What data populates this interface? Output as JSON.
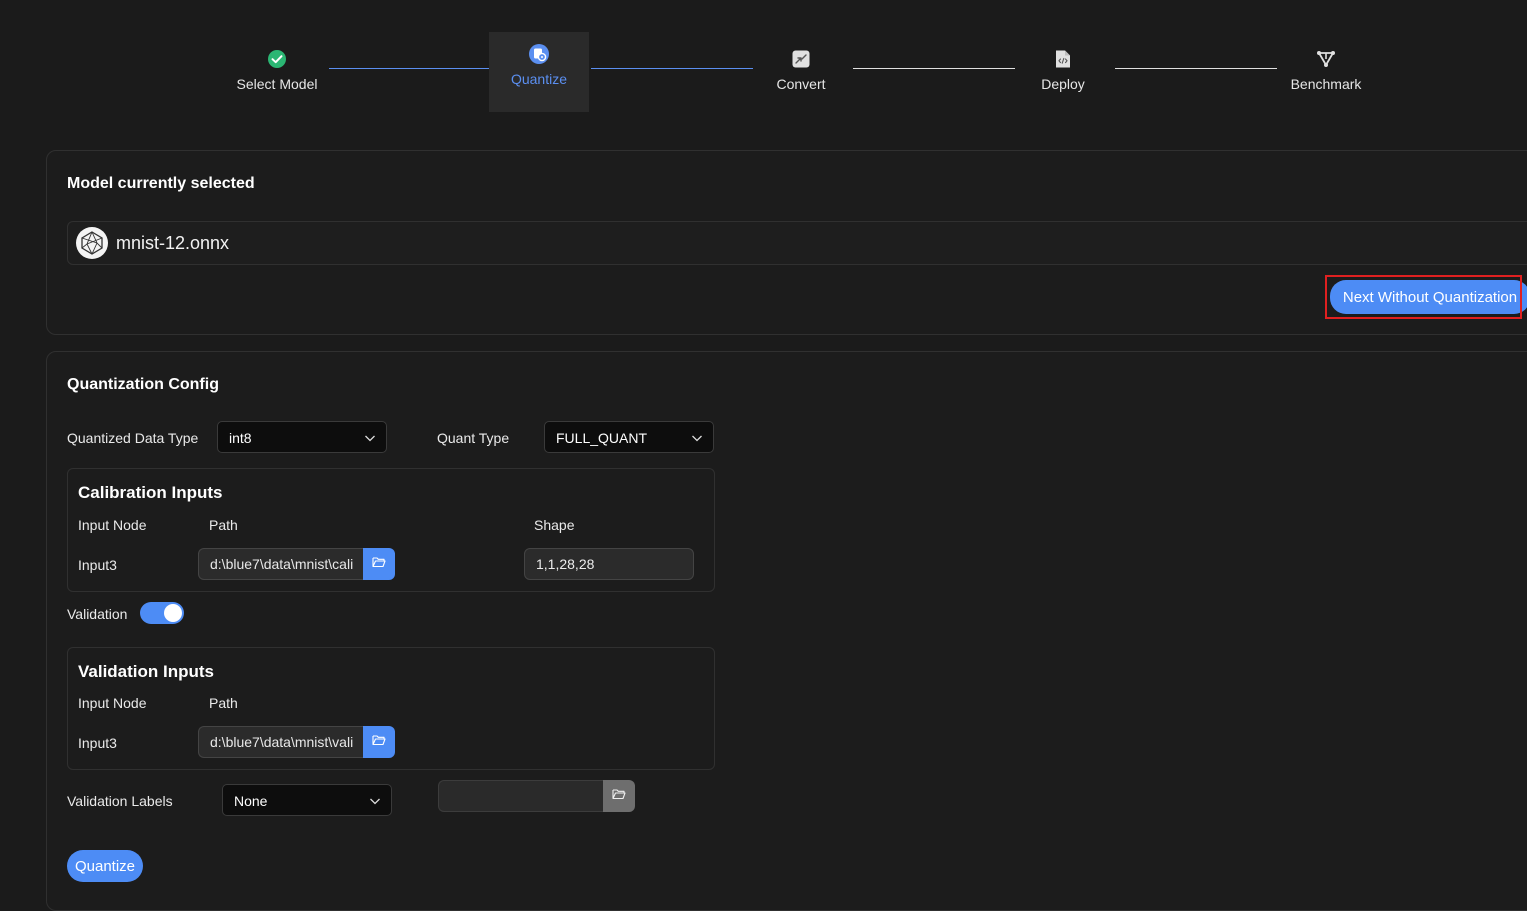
{
  "stepper": {
    "steps": [
      {
        "label": "Select Model",
        "icon": "check-circle-icon",
        "state": "done"
      },
      {
        "label": "Quantize",
        "icon": "quantize-icon",
        "state": "active"
      },
      {
        "label": "Convert",
        "icon": "convert-icon",
        "state": "pending"
      },
      {
        "label": "Deploy",
        "icon": "deploy-icon",
        "state": "pending"
      },
      {
        "label": "Benchmark",
        "icon": "benchmark-icon",
        "state": "pending"
      }
    ],
    "colors": {
      "done": "#2bb673",
      "active": "#5b8ff0",
      "pending_line": "#e0e0e0"
    }
  },
  "model_card": {
    "title": "Model currently selected",
    "model_name": "mnist-12.onnx",
    "next_button": "Next Without Quantization"
  },
  "quant_config": {
    "title": "Quantization Config",
    "data_type_label": "Quantized Data Type",
    "data_type_value": "int8",
    "quant_type_label": "Quant Type",
    "quant_type_value": "FULL_QUANT",
    "calibration": {
      "title": "Calibration Inputs",
      "headers": {
        "node": "Input Node",
        "path": "Path",
        "shape": "Shape"
      },
      "row": {
        "node": "Input3",
        "path": "d:\\blue7\\data\\mnist\\cali",
        "shape": "1,1,28,28"
      }
    },
    "validation_label": "Validation",
    "validation_enabled": true,
    "validation": {
      "title": "Validation Inputs",
      "headers": {
        "node": "Input Node",
        "path": "Path"
      },
      "row": {
        "node": "Input3",
        "path": "d:\\blue7\\data\\mnist\\vali"
      }
    },
    "labels_label": "Validation Labels",
    "labels_value": "None",
    "labels_path": "",
    "quantize_button": "Quantize"
  },
  "theme": {
    "accent": "#4d8cf5",
    "background": "#1b1b1b",
    "highlight": "#e02020"
  }
}
